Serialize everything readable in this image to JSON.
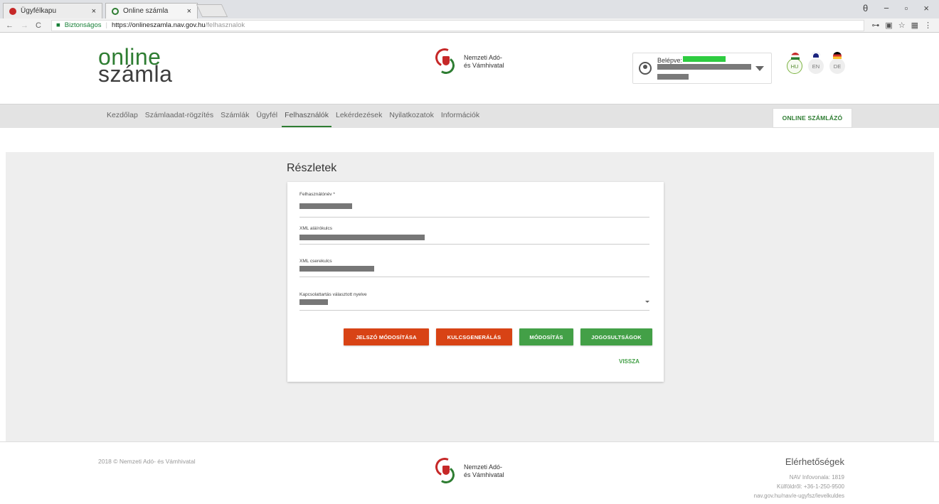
{
  "browser": {
    "tabs": [
      {
        "label": "Ügyfélkapu",
        "close": "×"
      },
      {
        "label": "Online számla",
        "close": "×"
      }
    ],
    "window_controls": {
      "account": "θ",
      "minimize": "−",
      "maximize": "▫",
      "close": "×"
    },
    "url": {
      "secure_label": "Biztonságos",
      "scheme_host": "https://onlineszamla.nav.gov.hu",
      "path": "/felhasznalok"
    }
  },
  "header": {
    "logo_line1": "online",
    "logo_line2": "számla",
    "agency_line1": "Nemzeti Adó-",
    "agency_line2": "és Vámhivatal",
    "login_label": "Belépve:",
    "languages": [
      {
        "code": "HU",
        "active": true
      },
      {
        "code": "EN",
        "active": false
      },
      {
        "code": "DE",
        "active": false
      }
    ]
  },
  "nav": {
    "items": [
      {
        "label": "Kezdőlap"
      },
      {
        "label": "Számlaadat-rögzítés"
      },
      {
        "label": "Számlák"
      },
      {
        "label": "Ügyfél"
      },
      {
        "label": "Felhasználók",
        "active": true
      },
      {
        "label": "Lekérdezések"
      },
      {
        "label": "Nyilatkozatok"
      },
      {
        "label": "Információk"
      }
    ],
    "online_button": "ONLINE SZÁMLÁZÓ"
  },
  "details": {
    "title": "Részletek",
    "fields": {
      "username_label": "Felhasználónév *",
      "sign_key_label": "XML aláírókulcs",
      "exchange_key_label": "XML cserekulcs",
      "language_label": "Kapcsolattartás választott nyelve"
    },
    "buttons": {
      "change_password": "JELSZÓ MÓDOSÍTÁSA",
      "key_generation": "KULCSGENERÁLÁS",
      "modify": "MÓDOSÍTÁS",
      "permissions": "JOGOSULTSÁGOK",
      "back": "VISSZA"
    }
  },
  "footer": {
    "copyright": "2018 © Nemzeti Adó- és Vámhivatal",
    "agency_line1": "Nemzeti Adó-",
    "agency_line2": "és Vámhivatal",
    "contacts_title": "Elérhetőségek",
    "contacts": [
      "NAV Infovonala: 1819",
      "Külföldről: +36-1-250-9500",
      "nav.gov.hu/nav/e-ugyfsz/levelkuldes"
    ]
  },
  "colors": {
    "accent_green": "#43a047",
    "accent_orange": "#d84315",
    "nav_bg": "#e3e3e3",
    "content_bg": "#eeeeee"
  }
}
